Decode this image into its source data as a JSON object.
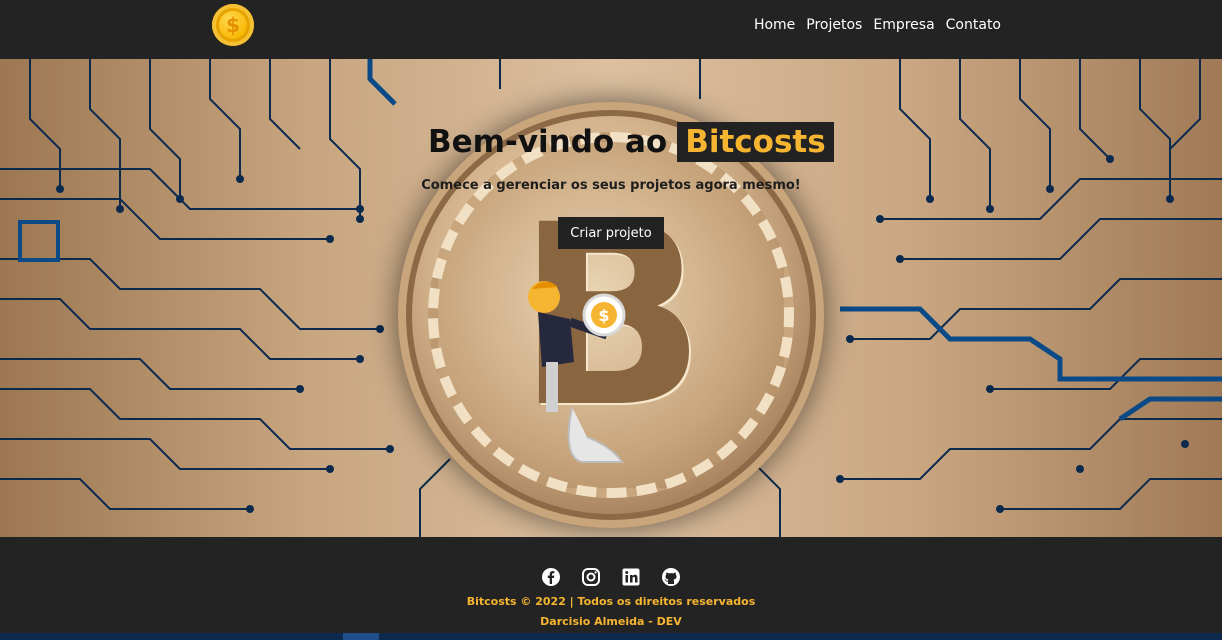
{
  "header": {
    "logo_icon": "coin-dollar-icon",
    "logo_glyph": "$",
    "nav": [
      {
        "label": "Home"
      },
      {
        "label": "Projetos"
      },
      {
        "label": "Empresa"
      },
      {
        "label": "Contato"
      }
    ]
  },
  "hero": {
    "title_prefix": "Bem-vindo ao",
    "title_brand": "Bitcosts",
    "subtitle": "Comece a gerenciar os seus projetos agora mesmo!",
    "cta_label": "Criar projeto",
    "coin_glyph": "B",
    "money_glyph": "$"
  },
  "footer": {
    "social_icons": [
      "facebook-icon",
      "instagram-icon",
      "linkedin-icon",
      "github-icon"
    ],
    "copyright": "Bitcosts © 2022 | Todos os direitos reservados",
    "developer": "Darcisio Almeida - DEV"
  },
  "colors": {
    "nav_bg": "#232323",
    "brand_yellow": "#f6b530",
    "circuit_blue": "#0b2a4d",
    "hero_gold": "#c7a57f"
  }
}
